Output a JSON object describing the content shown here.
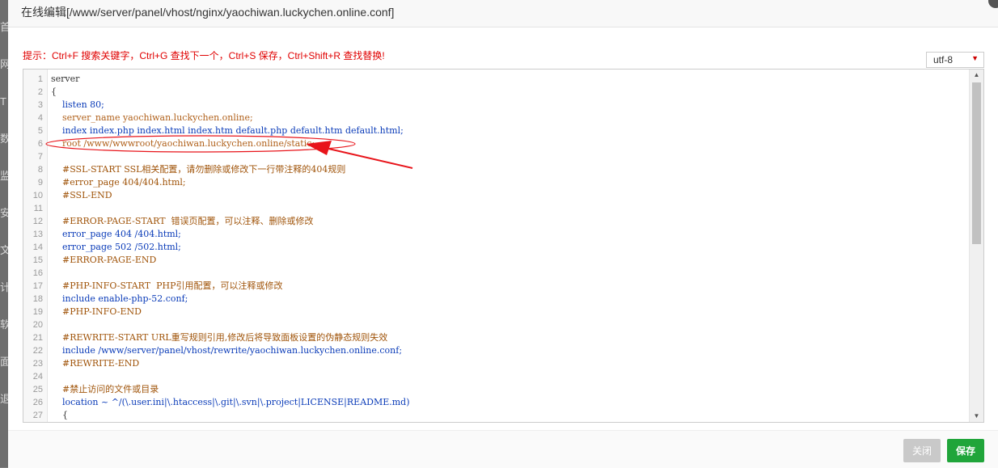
{
  "left_strip_chars": [
    "首",
    "网",
    "T",
    "数",
    "监",
    "安",
    "文",
    "计",
    "软",
    "面",
    "退"
  ],
  "dialog": {
    "title": "在线编辑[/www/server/panel/vhost/nginx/yaochiwan.luckychen.online.conf]"
  },
  "hint": "提示：Ctrl+F 搜索关键字，Ctrl+G 查找下一个，Ctrl+S 保存，Ctrl+Shift+R 查找替换!",
  "encoding": {
    "selected": "utf-8"
  },
  "editor": {
    "lines": [
      "server",
      "{",
      "    listen 80;",
      "    server_name yaochiwan.luckychen.online;",
      "    index index.php index.html index.htm default.php default.htm default.html;",
      "    root /www/wwwroot/yaochiwan.luckychen.online/static;",
      "",
      "    #SSL-START SSL相关配置，请勿删除或修改下一行带注释的404规则",
      "    #error_page 404/404.html;",
      "    #SSL-END",
      "",
      "    #ERROR-PAGE-START  错误页配置，可以注释、删除或修改",
      "    error_page 404 /404.html;",
      "    error_page 502 /502.html;",
      "    #ERROR-PAGE-END",
      "",
      "    #PHP-INFO-START  PHP引用配置，可以注释或修改",
      "    include enable-php-52.conf;",
      "    #PHP-INFO-END",
      "",
      "    #REWRITE-START URL重写规则引用,修改后将导致面板设置的伪静态规则失效",
      "    include /www/server/panel/vhost/rewrite/yaochiwan.luckychen.online.conf;",
      "    #REWRITE-END",
      "",
      "    #禁止访问的文件或目录",
      "    location ~ ^/(\\.user.ini|\\.htaccess|\\.git|\\.svn|\\.project|LICENSE|README.md)",
      "    {"
    ],
    "highlighted_line": 6
  },
  "footer": {
    "close_label": "关闭",
    "save_label": "保存"
  },
  "colors": {
    "annotation_red": "#e8141a",
    "save_green": "#20a53a",
    "hint_red": "#e00000"
  }
}
